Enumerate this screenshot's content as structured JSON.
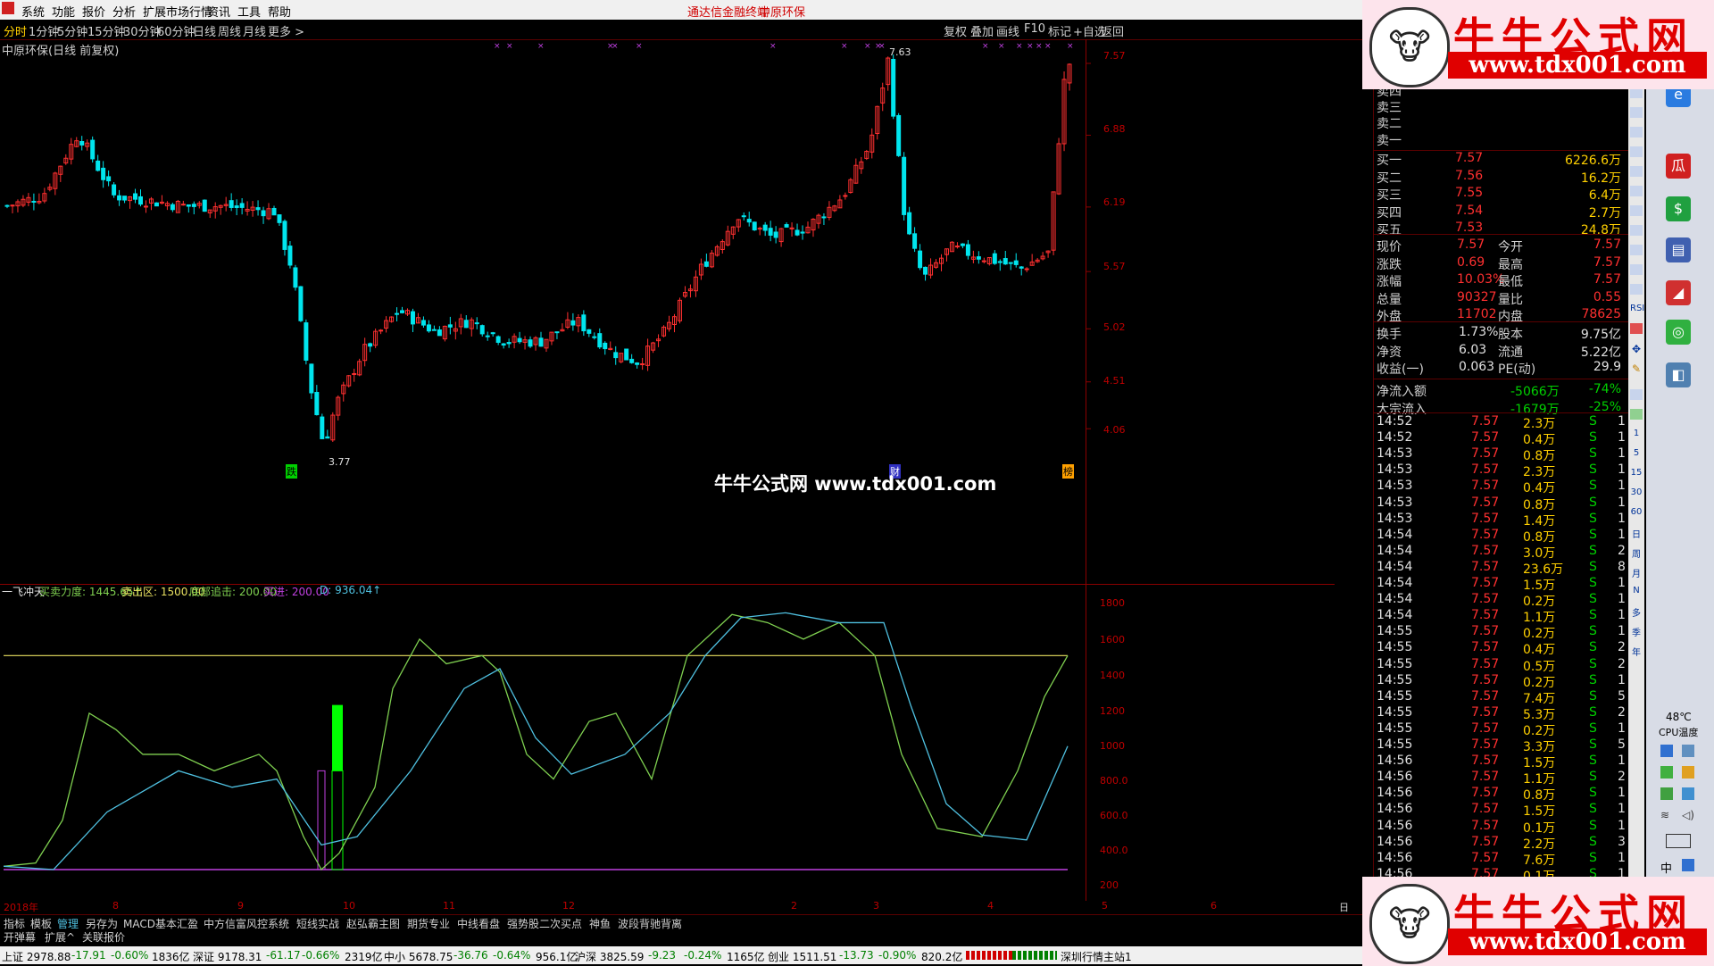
{
  "menu": [
    "系统",
    "功能",
    "报价",
    "分析",
    "扩展市场行情",
    "资讯",
    "工具",
    "帮助"
  ],
  "menu_center": [
    "通达信金融终端",
    "中原环保"
  ],
  "periods": [
    "分时",
    "1分钟",
    "5分钟",
    "15分钟",
    "30分钟",
    "60分钟",
    "日线",
    "周线",
    "月线",
    "更多 >"
  ],
  "active_period": "日线",
  "toolbar_right": [
    "复权",
    "叠加",
    "画线",
    "F10",
    "标记",
    "+自选",
    "返回"
  ],
  "stock_title": "中原环保(日线 前复权)",
  "price_axis": [
    "7.57",
    "6.88",
    "6.19",
    "5.57",
    "5.02",
    "4.51",
    "4.06"
  ],
  "high_label": "7.63",
  "low_label": "3.77",
  "marker_die": "跌",
  "marker_cai": "财",
  "marker_bang": "榜",
  "center_watermark": "牛牛公式网 www.tdx001.com",
  "indicator": {
    "name": "一飞冲天",
    "f1": "买卖力度: 1445.65↑",
    "f2": "卖出区: 1500.00",
    "f3": "底部追击: 200.00",
    "f4": "买进: 200.00",
    "f5": "D: 936.04↑"
  },
  "ind_axis": [
    "1800",
    "1600",
    "1400",
    "1200",
    "1000",
    "800.0",
    "600.0",
    "400.0",
    "200"
  ],
  "date_axis": [
    "2018年",
    "8",
    "9",
    "10",
    "11",
    "12",
    "2",
    "3",
    "4",
    "5",
    "6"
  ],
  "period_corner": "日线",
  "tabs1": [
    "指标",
    "模板",
    "管理",
    "另存为",
    "MACD基本",
    "汇盈",
    "中方信富风控系统",
    "短线实战",
    "赵弘霸主图",
    "期货专业",
    "中线看盘",
    "强势股二次买点",
    "神鱼",
    "波段背驰背离"
  ],
  "tabs2": [
    "开弹幕",
    "扩展^",
    "关联报价"
  ],
  "status": [
    "上证 2978.88",
    "-17.91",
    "-0.60%",
    "1836亿",
    "深证 9178.31",
    "-61.17",
    "-0.66%",
    "2319亿",
    "中小 5678.75",
    "-36.76",
    "-0.64%",
    "956.1亿",
    "沪深 3825.59",
    "-9.23",
    "-0.24%",
    "1165亿",
    "创业 1511.51",
    "-13.73",
    "-0.90%",
    "820.2亿",
    "深圳行情主站1"
  ],
  "order_book": {
    "sell": [
      "卖四",
      "卖三",
      "卖二",
      "卖一"
    ],
    "buy": [
      {
        "label": "买一",
        "price": "7.57",
        "vol": "6226.6万"
      },
      {
        "label": "买二",
        "price": "7.56",
        "vol": "16.2万"
      },
      {
        "label": "买三",
        "price": "7.55",
        "vol": "6.4万"
      },
      {
        "label": "买四",
        "price": "7.54",
        "vol": "2.7万"
      },
      {
        "label": "买五",
        "price": "7.53",
        "vol": "24.8万"
      }
    ]
  },
  "quote": [
    {
      "l1": "现价",
      "v1": "7.57",
      "l2": "今开",
      "v2": "7.57"
    },
    {
      "l1": "涨跌",
      "v1": "0.69",
      "l2": "最高",
      "v2": "7.57"
    },
    {
      "l1": "涨幅",
      "v1": "10.03%",
      "l2": "最低",
      "v2": "7.57"
    },
    {
      "l1": "总量",
      "v1": "90327",
      "l2": "量比",
      "v2": "0.55"
    },
    {
      "l1": "外盘",
      "v1": "11702",
      "l2": "内盘",
      "v2": "78625"
    }
  ],
  "stats": [
    {
      "l1": "换手",
      "v1": "1.73%",
      "l2": "股本",
      "v2": "9.75亿"
    },
    {
      "l1": "净资",
      "v1": "6.03",
      "l2": "流通",
      "v2": "5.22亿"
    },
    {
      "l1": "收益(一)",
      "v1": "0.063",
      "l2": "PE(动)",
      "v2": "29.9"
    }
  ],
  "flows": [
    {
      "l": "净流入额",
      "v": "-5066万",
      "p": "-74%"
    },
    {
      "l": "大宗流入",
      "v": "-1679万",
      "p": "-25%"
    }
  ],
  "trades": [
    {
      "t": "14:52",
      "p": "7.57",
      "v": "2.3万",
      "s": "S",
      "n": "1"
    },
    {
      "t": "14:52",
      "p": "7.57",
      "v": "0.4万",
      "s": "S",
      "n": "1"
    },
    {
      "t": "14:53",
      "p": "7.57",
      "v": "0.8万",
      "s": "S",
      "n": "1"
    },
    {
      "t": "14:53",
      "p": "7.57",
      "v": "2.3万",
      "s": "S",
      "n": "1"
    },
    {
      "t": "14:53",
      "p": "7.57",
      "v": "0.4万",
      "s": "S",
      "n": "1"
    },
    {
      "t": "14:53",
      "p": "7.57",
      "v": "0.8万",
      "s": "S",
      "n": "1"
    },
    {
      "t": "14:53",
      "p": "7.57",
      "v": "1.4万",
      "s": "S",
      "n": "1"
    },
    {
      "t": "14:54",
      "p": "7.57",
      "v": "0.8万",
      "s": "S",
      "n": "1"
    },
    {
      "t": "14:54",
      "p": "7.57",
      "v": "3.0万",
      "s": "S",
      "n": "2"
    },
    {
      "t": "14:54",
      "p": "7.57",
      "v": "23.6万",
      "s": "S",
      "n": "8"
    },
    {
      "t": "14:54",
      "p": "7.57",
      "v": "1.5万",
      "s": "S",
      "n": "1"
    },
    {
      "t": "14:54",
      "p": "7.57",
      "v": "0.2万",
      "s": "S",
      "n": "1"
    },
    {
      "t": "14:54",
      "p": "7.57",
      "v": "1.1万",
      "s": "S",
      "n": "1"
    },
    {
      "t": "14:55",
      "p": "7.57",
      "v": "0.2万",
      "s": "S",
      "n": "1"
    },
    {
      "t": "14:55",
      "p": "7.57",
      "v": "0.4万",
      "s": "S",
      "n": "2"
    },
    {
      "t": "14:55",
      "p": "7.57",
      "v": "0.5万",
      "s": "S",
      "n": "2"
    },
    {
      "t": "14:55",
      "p": "7.57",
      "v": "0.2万",
      "s": "S",
      "n": "1"
    },
    {
      "t": "14:55",
      "p": "7.57",
      "v": "7.4万",
      "s": "S",
      "n": "5"
    },
    {
      "t": "14:55",
      "p": "7.57",
      "v": "5.3万",
      "s": "S",
      "n": "2"
    },
    {
      "t": "14:55",
      "p": "7.57",
      "v": "0.2万",
      "s": "S",
      "n": "1"
    },
    {
      "t": "14:55",
      "p": "7.57",
      "v": "3.3万",
      "s": "S",
      "n": "5"
    },
    {
      "t": "14:56",
      "p": "7.57",
      "v": "1.5万",
      "s": "S",
      "n": "1"
    },
    {
      "t": "14:56",
      "p": "7.57",
      "v": "1.1万",
      "s": "S",
      "n": "2"
    },
    {
      "t": "14:56",
      "p": "7.57",
      "v": "0.8万",
      "s": "S",
      "n": "1"
    },
    {
      "t": "14:56",
      "p": "7.57",
      "v": "1.5万",
      "s": "S",
      "n": "1"
    },
    {
      "t": "14:56",
      "p": "7.57",
      "v": "0.1万",
      "s": "S",
      "n": "1"
    },
    {
      "t": "14:56",
      "p": "7.57",
      "v": "2.2万",
      "s": "S",
      "n": "3"
    },
    {
      "t": "14:56",
      "p": "7.57",
      "v": "7.6万",
      "s": "S",
      "n": "1"
    },
    {
      "t": "14:56",
      "p": "7.57",
      "v": "0.1万",
      "s": "S",
      "n": "1"
    }
  ],
  "side_tools": [
    "RSI",
    "1",
    "5",
    "15",
    "30",
    "60",
    "日",
    "周",
    "月",
    "N",
    "多",
    "季",
    "年"
  ],
  "dock_status": {
    "temp": "48℃",
    "label": "CPU温度",
    "ime": "中"
  },
  "ad": {
    "title": "牛牛公式网",
    "url": "www.tdx001.com"
  },
  "colors": {
    "up": "#ff3030",
    "down": "#00e5ee",
    "k_line": "#7fd050",
    "d_line": "#4fc0e0",
    "sell_zone": "#e8e060",
    "buy_zone": "#c040e0"
  },
  "chart_data": {
    "type": "candlestick",
    "price_range": [
      3.77,
      7.63
    ],
    "indicator_range": [
      200,
      1800
    ]
  }
}
